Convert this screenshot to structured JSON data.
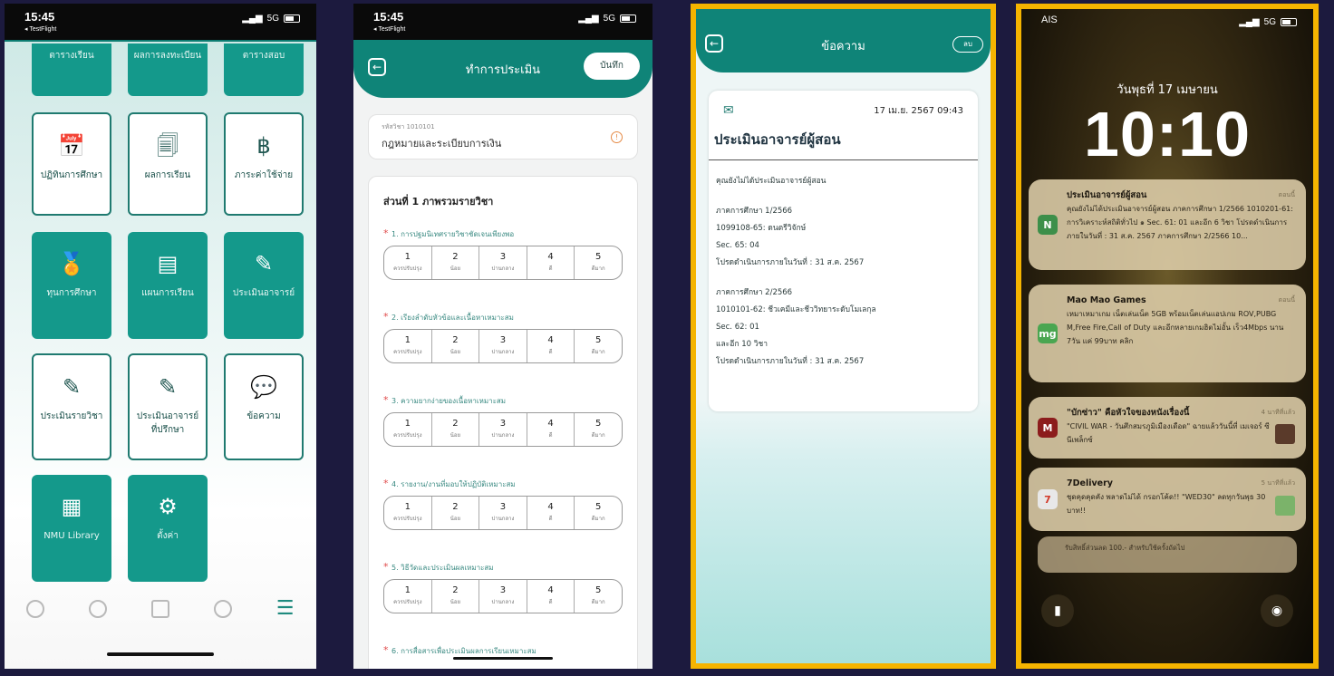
{
  "phone1": {
    "status": {
      "time": "15:45",
      "sub": "◂ TestFlight",
      "signal": "5G"
    },
    "top_tiles": [
      "ตารางเรียน",
      "ผลการลงทะเบียน",
      "ตารางสอบ"
    ],
    "tiles": [
      {
        "label": "ปฏิทินการศึกษา",
        "icon": "calendar-icon",
        "glyph": "📅",
        "style": "white"
      },
      {
        "label": "ผลการเรียน",
        "icon": "document-icon",
        "glyph": "🗐",
        "style": "white"
      },
      {
        "label": "ภาระค่าใช้จ่าย",
        "icon": "baht-icon",
        "glyph": "฿",
        "style": "white"
      },
      {
        "label": "ทุนการศึกษา",
        "icon": "medal-icon",
        "glyph": "🏅",
        "style": "green"
      },
      {
        "label": "แผนการเรียน",
        "icon": "notebook-icon",
        "glyph": "▤",
        "style": "green"
      },
      {
        "label": "ประเมินอาจารย์",
        "icon": "teacher-evaluate-icon",
        "glyph": "✎",
        "style": "green"
      },
      {
        "label": "ประเมินรายวิชา",
        "icon": "course-evaluate-icon",
        "glyph": "✎",
        "style": "white"
      },
      {
        "label": "ประเมินอาจารย์ที่ปรึกษา",
        "icon": "advisor-evaluate-icon",
        "glyph": "✎",
        "style": "white"
      },
      {
        "label": "ข้อความ",
        "icon": "message-icon",
        "glyph": "💬",
        "style": "white"
      },
      {
        "label": "NMU Library",
        "icon": "library-icon",
        "glyph": "▦",
        "style": "green"
      },
      {
        "label": "ตั้งค่า",
        "icon": "settings-gear-icon",
        "glyph": "⚙",
        "style": "green"
      }
    ]
  },
  "phone2": {
    "status": {
      "time": "15:45",
      "sub": "◂ TestFlight",
      "signal": "5G"
    },
    "title": "ทำการประเมิน",
    "save_label": "บันทึก",
    "course_code": "รหัสวิชา 1010101",
    "course_name": "กฎหมายและระเบียบการเงิน",
    "section_title": "ส่วนที่ 1 ภาพรวมรายวิชา",
    "questions": [
      "1. การปฐมนิเทศรายวิชาชัดเจนเพียงพอ",
      "2. เรียงลำดับหัวข้อและเนื้อหาเหมาะสม",
      "3. ความยากง่ายของเนื้อหาเหมาะสม",
      "4. รายงาน/งานที่มอบให้ปฏิบัติเหมาะสม",
      "5. วิธีวัดและประเมินผลเหมาะสม",
      "6. การสื่อสารเพื่อประเมินผลการเรียนเหมาะสม"
    ],
    "scale": [
      {
        "num": "1",
        "label": "ควรปรับปรุง"
      },
      {
        "num": "2",
        "label": "น้อย"
      },
      {
        "num": "3",
        "label": "ปานกลาง"
      },
      {
        "num": "4",
        "label": "ดี"
      },
      {
        "num": "5",
        "label": "ดีมาก"
      }
    ]
  },
  "phone3": {
    "title": "ข้อความ",
    "delete_label": "ลบ",
    "date": "17 เม.ย. 2567 09:43",
    "msg_title": "ประเมินอาจารย์ผู้สอน",
    "intro": "คุณยังไม่ได้ประเมินอาจารย์ผู้สอน",
    "block1": [
      "ภาคการศึกษา 1/2566",
      "1099108-65: ดนตรีวิจักษ์",
      "Sec. 65: 04",
      "โปรดดำเนินการภายในวันที่ : 31 ส.ค. 2567"
    ],
    "block2": [
      "ภาคการศึกษา 2/2566",
      "1010101-62: ชีวเคมีและชีววิทยาระดับโมเลกุล",
      "Sec. 62: 01",
      "และอีก 10 วิชา",
      "โปรดดำเนินการภายในวันที่ : 31 ส.ค. 2567"
    ]
  },
  "phone4": {
    "carrier": "AIS",
    "signal": "5G",
    "date": "วันพุธที่ 17 เมษายน",
    "time": "10:10",
    "notifications": [
      {
        "title": "ประเมินอาจารย์ผู้สอน",
        "time": "ตอนนี้",
        "body": "คุณยังไม่ได้ประเมินอาจารย์ผู้สอน ภาคการศึกษา 1/2566 1010201-61: การวิเคราะห์สถิติทั่วไป ๑ Sec. 61: 01 และอีก 6 วิชา โปรดดำเนินการภายในวันที่ : 31 ส.ค. 2567 ภาคการศึกษา 2/2566 10...",
        "icon_text": "N",
        "icon_color": "#3d8f4a"
      },
      {
        "title": "Mao Mao Games",
        "time": "ตอนนี้",
        "body": "เหมาเหมาเกม เน็ตเล่นเน็ต 5GB พร้อมเน็ตเล่นแอปเกม ROV,PUBG M,Free Fire,Call of Duty และอีกหลายเกมฮิตไม่อั้น เร็ว4Mbps นาน 7วัน แค่ 99บาท คลิก",
        "icon_text": "mg",
        "icon_color": "#4aa651"
      },
      {
        "title": "\"บักซ่าว\" คือหัวใจของหนังเรื่องนี้",
        "time": "4 นาทีที่แล้ว",
        "body": "\"CIVIL WAR - วันศึกสมรภูมิเมืองเดือด\" ฉายแล้ววันนี้ที่ เมเจอร์ ซีนีเพล็กซ์",
        "icon_text": "M",
        "icon_color": "#8c1c1c"
      },
      {
        "title": "7Delivery",
        "time": "5 นาทีที่แล้ว",
        "body": "ชุดคุดคุดคัง พลาดไม่ได้ กรอกโค้ด!! \"WED30\" ลดทุกวันพุธ 30 บาท!!",
        "icon_text": "7",
        "icon_color": "#e8e8e8"
      }
    ],
    "stacked_body": "รับสิทธิ์ส่วนลด 100.- สำหรับใช้ครั้งถัดไป"
  }
}
